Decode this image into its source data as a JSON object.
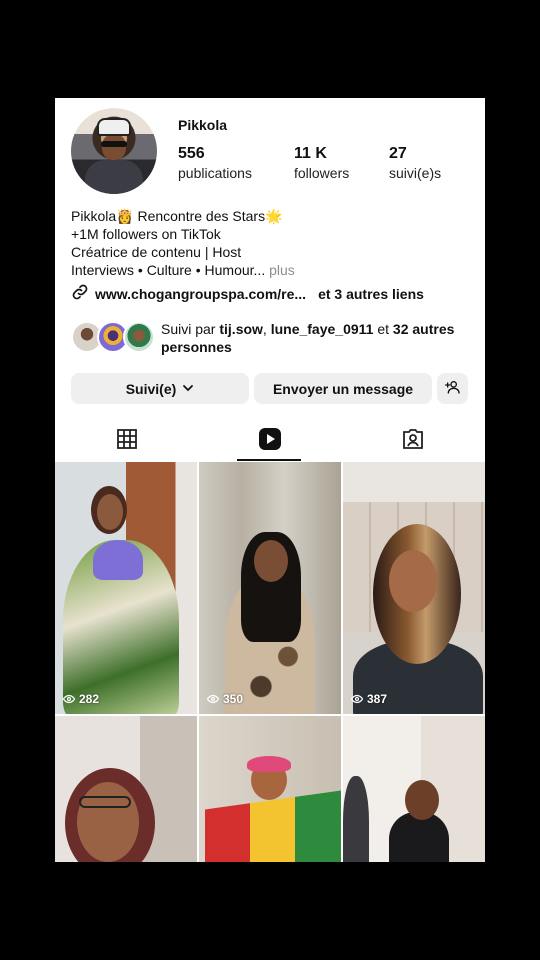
{
  "profile": {
    "username": "Pikkola",
    "stats": [
      {
        "value": "556",
        "label": "publications"
      },
      {
        "value": "11 K",
        "label": "followers"
      },
      {
        "value": "27",
        "label": "suivi(e)s"
      }
    ],
    "bio": [
      "Pikkola👸 Rencontre des Stars🌟",
      "+1M followers on TikTok",
      "Créatrice de contenu | Host",
      "Interviews • Culture • Humour..."
    ],
    "bio_more": "plus",
    "link": "www.chogangroupspa.com/re...",
    "link_more": "et 3 autres liens",
    "followed_by_prefix": "Suivi par",
    "followed_by_user1": "tij.sow",
    "followed_by_sep": ",",
    "followed_by_user2": "lune_faye_0911",
    "followed_by_and": "et",
    "followed_by_rest": "32 autres personnes"
  },
  "actions": {
    "follow_label": "Suivi(e)",
    "message_label": "Envoyer un message"
  },
  "tabs": [
    {
      "icon": "grid-icon"
    },
    {
      "icon": "reels-icon",
      "active": true
    },
    {
      "icon": "tagged-icon"
    }
  ],
  "reels": [
    {
      "views": "282"
    },
    {
      "views": "350"
    },
    {
      "views": "387"
    },
    {
      "views": ""
    },
    {
      "views": ""
    },
    {
      "views": ""
    }
  ],
  "colors": {
    "button_bg": "#efefef",
    "secondary_text": "#8e8e8e",
    "background": "#ffffff"
  }
}
